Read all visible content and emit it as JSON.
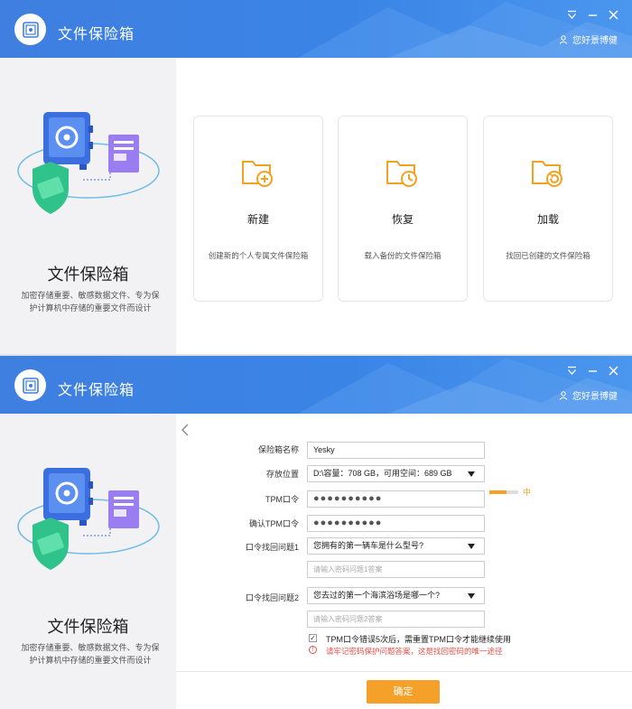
{
  "app": {
    "title": "文件保险箱",
    "user": "您好景博健"
  },
  "left": {
    "title": "文件保险箱",
    "desc": "加密存储重要、敏感数据文件、专为保护计算机中存储的重要文件而设计"
  },
  "cards": [
    {
      "icon": "folder-add-icon",
      "title": "新建",
      "desc": "创建新的个人专属文件保险箱"
    },
    {
      "icon": "folder-restore-icon",
      "title": "恢复",
      "desc": "载入备份的文件保险箱"
    },
    {
      "icon": "folder-load-icon",
      "title": "加载",
      "desc": "找回已创建的文件保险箱"
    }
  ],
  "form": {
    "name_label": "保险箱名称",
    "name_value": "Yesky",
    "location_label": "存放位置",
    "location_value": "D:\\容量：708 GB，可用空间：689 GB",
    "tpm_label": "TPM口令",
    "tpm_value": "●●●●●●●●●●",
    "strength_text": "中",
    "strength_level": 0.6,
    "confirm_label": "确认TPM口令",
    "confirm_value": "●●●●●●●●●●",
    "q1_label": "口令找回问题1",
    "q1_value": "您拥有的第一辆车是什么型号?",
    "a1_placeholder": "请输入密码问题1答案",
    "q2_label": "口令找回问题2",
    "q2_value": "您去过的第一个海滨浴场是哪一个?",
    "a2_placeholder": "请输入密码问题2答案",
    "checkbox_text": "TPM口令错误5次后，需重置TPM口令才能继续使用",
    "warning_text": "请牢记密码保护问题答案，这是找回密码的唯一途径",
    "submit_label": "确定"
  },
  "colors": {
    "primary": "#3f7fe0",
    "accent": "#f5a029",
    "warning": "#e8504a"
  }
}
